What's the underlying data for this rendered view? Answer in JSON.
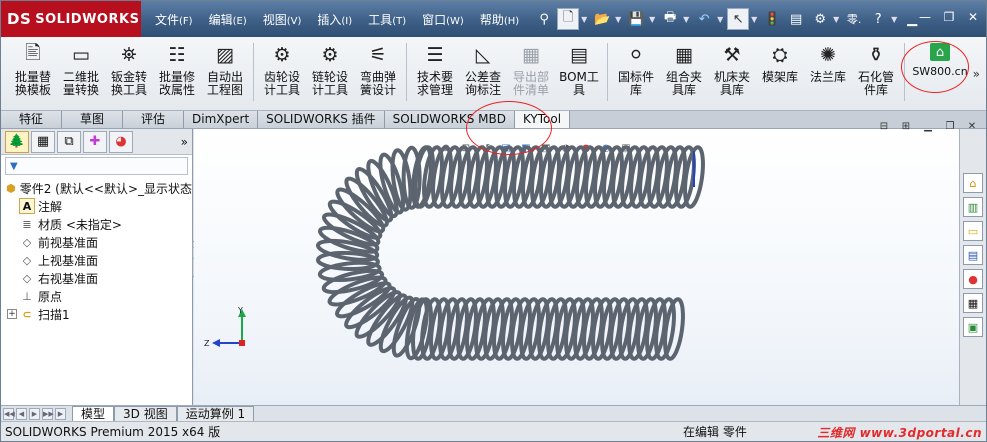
{
  "brand": {
    "symbol": "DS",
    "name": "SOLIDWORKS"
  },
  "menu": [
    {
      "label": "文件",
      "key": "(F)"
    },
    {
      "label": "编辑",
      "key": "(E)"
    },
    {
      "label": "视图",
      "key": "(V)"
    },
    {
      "label": "插入",
      "key": "(I)"
    },
    {
      "label": "工具",
      "key": "(T)"
    },
    {
      "label": "窗口",
      "key": "(W)"
    },
    {
      "label": "帮助",
      "key": "(H)"
    }
  ],
  "quick": {
    "help_menu": "零.",
    "help_btn": "?"
  },
  "ribbon": {
    "buttons": [
      {
        "label": "批量替\n换模板",
        "icon": "batch-replace-icon"
      },
      {
        "label": "二维批\n量转换",
        "icon": "batch-convert-icon"
      },
      {
        "label": "钣金转\n换工具",
        "icon": "sheetmetal-icon"
      },
      {
        "label": "批量修\n改属性",
        "icon": "batch-edit-icon"
      },
      {
        "label": "自动出\n工程图",
        "icon": "auto-drawing-icon"
      },
      {
        "label": "齿轮设\n计工具",
        "icon": "gear-icon"
      },
      {
        "label": "链轮设\n计工具",
        "icon": "sprocket-icon"
      },
      {
        "label": "弯曲弹\n簧设计",
        "icon": "spring-icon"
      },
      {
        "label": "技术要\n求管理",
        "icon": "tech-req-icon"
      },
      {
        "label": "公差查\n询标注",
        "icon": "tolerance-icon"
      },
      {
        "label": "导出部\n件清单",
        "icon": "export-bom-icon",
        "disabled": true
      },
      {
        "label": "BOM工\n具",
        "icon": "bom-icon"
      },
      {
        "label": "国标件\n库",
        "icon": "standard-parts-icon"
      },
      {
        "label": "组合夹\n具库",
        "icon": "fixture-icon"
      },
      {
        "label": "机床夹\n具库",
        "icon": "machine-fixture-icon"
      },
      {
        "label": "模架库",
        "icon": "mold-base-icon"
      },
      {
        "label": "法兰库",
        "icon": "flange-icon"
      },
      {
        "label": "石化管\n件库",
        "icon": "pipe-fitting-icon"
      }
    ],
    "home": {
      "label": "SW800.cn",
      "icon": "home-icon"
    },
    "more": "»"
  },
  "command_tabs": [
    {
      "label": "特征",
      "wide": true
    },
    {
      "label": "草图",
      "wide": true
    },
    {
      "label": "评估",
      "wide": true
    },
    {
      "label": "DimXpert"
    },
    {
      "label": "SOLIDWORKS 插件"
    },
    {
      "label": "SOLIDWORKS MBD"
    },
    {
      "label": "KYTool",
      "active": true
    }
  ],
  "feature_tree": {
    "root": "零件2 (默认<<默认>_显示状态",
    "items": [
      {
        "label": "注解",
        "icon": "annotation-icon"
      },
      {
        "label": "材质 <未指定>",
        "icon": "material-icon"
      },
      {
        "label": "前视基准面",
        "icon": "plane-icon"
      },
      {
        "label": "上视基准面",
        "icon": "plane-icon"
      },
      {
        "label": "右视基准面",
        "icon": "plane-icon"
      },
      {
        "label": "原点",
        "icon": "origin-icon"
      },
      {
        "label": "扫描1",
        "icon": "sweep-icon"
      }
    ],
    "more": "»"
  },
  "triad": {
    "x": "X",
    "y": "Y",
    "z": "Z"
  },
  "model_tabs": [
    {
      "label": "模型",
      "active": true
    },
    {
      "label": "3D 视图"
    },
    {
      "label": "运动算例 1"
    }
  ],
  "status": {
    "left": "SOLIDWORKS Premium 2015 x64 版",
    "right": "在编辑 零件",
    "watermark": "三维网 www.3dportal.cn"
  },
  "colors": {
    "accent_red": "#e22222",
    "brand_red": "#b80f1e",
    "spring": "#5c6470"
  }
}
